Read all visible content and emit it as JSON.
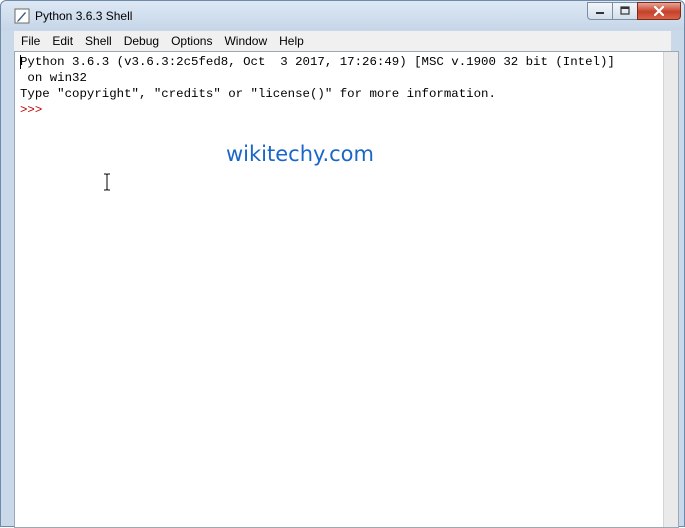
{
  "window": {
    "title": "Python 3.6.3 Shell"
  },
  "menu": {
    "items": [
      "File",
      "Edit",
      "Shell",
      "Debug",
      "Options",
      "Window",
      "Help"
    ]
  },
  "shell": {
    "line1": "Python 3.6.3 (v3.6.3:2c5fed8, Oct  3 2017, 17:26:49) [MSC v.1900 32 bit (Intel)]",
    "line2": " on win32",
    "line3": "Type \"copyright\", \"credits\" or \"license()\" for more information.",
    "prompt": ">>> "
  },
  "watermark": {
    "text": "wikitechy.com"
  },
  "colors": {
    "prompt": "#c00000",
    "watermark": "#1b66c9"
  }
}
